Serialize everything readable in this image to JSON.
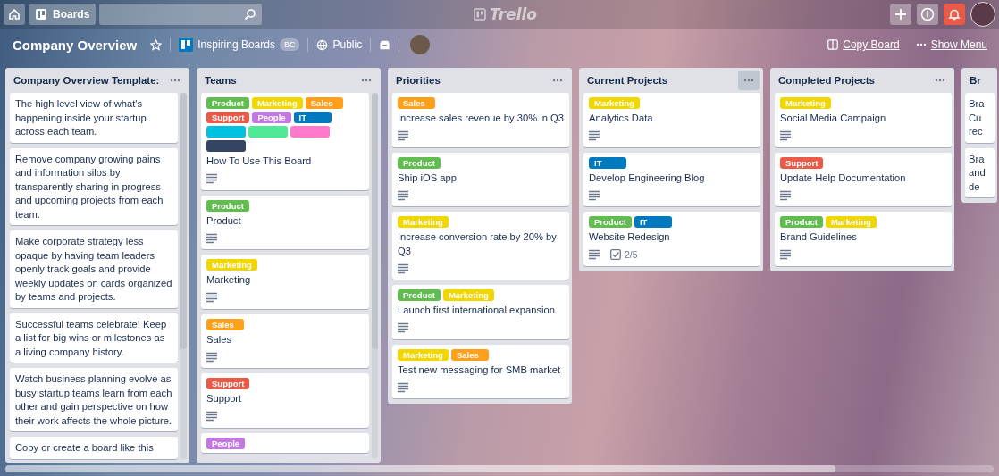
{
  "top_bar": {
    "boards_button": "Boards",
    "logo": "Trello"
  },
  "board_header": {
    "title": "Company Overview",
    "starred": false,
    "team": "Inspiring Boards",
    "team_badge": "BC",
    "visibility": "Public",
    "copy_board": "Copy Board",
    "show_menu": "Show Menu"
  },
  "lists": [
    {
      "title": "Company Overview Template:",
      "scrollbar": true,
      "cards": [
        {
          "title": "The high level view of what's happening inside your startup across each team.",
          "description": false
        },
        {
          "title": "Remove company growing pains and information silos by transparently sharing in progress and upcoming projects from each team.",
          "description": false
        },
        {
          "title": "Make corporate strategy less opaque by having team leaders openly track goals and provide weekly updates on cards organized by teams and projects.",
          "description": false
        },
        {
          "title": "Successful teams celebrate! Keep a list for big wins or milestones as a living company history.",
          "description": false
        },
        {
          "title": "Watch business planning evolve as busy startup teams learn from each other and gain perspective on how their work affects the whole picture.",
          "description": false
        },
        {
          "title": "Copy or create a board like this",
          "description": false
        }
      ]
    },
    {
      "title": "Teams",
      "scrollbar": true,
      "cards": [
        {
          "labels": [
            {
              "text": "Product",
              "color": "#61bd4f"
            },
            {
              "text": "Marketing",
              "color": "#f2d600"
            },
            {
              "text": "Sales",
              "color": "#ff9f1a"
            },
            {
              "text": "Support",
              "color": "#eb5a46"
            },
            {
              "text": "People",
              "color": "#c377e0"
            },
            {
              "text": "IT",
              "color": "#0079bf"
            },
            {
              "color": "#00c2e0"
            },
            {
              "color": "#51e898"
            },
            {
              "color": "#ff78cb"
            },
            {
              "color": "#344563"
            }
          ],
          "title": "How To Use This Board",
          "description": true
        },
        {
          "labels": [
            {
              "text": "Product",
              "color": "#61bd4f"
            }
          ],
          "title": "Product",
          "description": true
        },
        {
          "labels": [
            {
              "text": "Marketing",
              "color": "#f2d600"
            }
          ],
          "title": "Marketing",
          "description": true
        },
        {
          "labels": [
            {
              "text": "Sales",
              "color": "#ff9f1a"
            }
          ],
          "title": "Sales",
          "description": true
        },
        {
          "labels": [
            {
              "text": "Support",
              "color": "#eb5a46"
            }
          ],
          "title": "Support",
          "description": true
        },
        {
          "labels": [
            {
              "text": "People",
              "color": "#c377e0"
            }
          ],
          "description": false
        }
      ]
    },
    {
      "title": "Priorities",
      "scrollbar": false,
      "cards": [
        {
          "labels": [
            {
              "text": "Sales",
              "color": "#ff9f1a"
            }
          ],
          "title": "Increase sales revenue by 30% in Q3",
          "description": true
        },
        {
          "labels": [
            {
              "text": "Product",
              "color": "#61bd4f"
            }
          ],
          "title": "Ship iOS app",
          "description": true
        },
        {
          "labels": [
            {
              "text": "Marketing",
              "color": "#f2d600"
            }
          ],
          "title": "Increase conversion rate by 20% by Q3",
          "description": true
        },
        {
          "labels": [
            {
              "text": "Product",
              "color": "#61bd4f"
            },
            {
              "text": "Marketing",
              "color": "#f2d600"
            }
          ],
          "title": "Launch first international expansion",
          "description": true
        },
        {
          "labels": [
            {
              "text": "Marketing",
              "color": "#f2d600"
            },
            {
              "text": "Sales",
              "color": "#ff9f1a"
            }
          ],
          "title": "Test new messaging for SMB market",
          "description": true
        }
      ]
    },
    {
      "title": "Current Projects",
      "menu_highlighted": true,
      "scrollbar": false,
      "cards": [
        {
          "labels": [
            {
              "text": "Marketing",
              "color": "#f2d600"
            }
          ],
          "title": "Analytics Data",
          "description": true
        },
        {
          "labels": [
            {
              "text": "IT",
              "color": "#0079bf"
            }
          ],
          "title": "Develop Engineering Blog",
          "description": true
        },
        {
          "labels": [
            {
              "text": "Product",
              "color": "#61bd4f"
            },
            {
              "text": "IT",
              "color": "#0079bf"
            }
          ],
          "title": "Website Redesign",
          "description": true,
          "checklist": "2/5"
        }
      ]
    },
    {
      "title": "Completed Projects",
      "scrollbar": false,
      "cards": [
        {
          "labels": [
            {
              "text": "Marketing",
              "color": "#f2d600"
            }
          ],
          "title": "Social Media Campaign",
          "description": true
        },
        {
          "labels": [
            {
              "text": "Support",
              "color": "#eb5a46"
            }
          ],
          "title": "Update Help Documentation",
          "description": true
        },
        {
          "labels": [
            {
              "text": "Product",
              "color": "#61bd4f"
            },
            {
              "text": "Marketing",
              "color": "#f2d600"
            }
          ],
          "title": "Brand Guidelines",
          "description": true
        }
      ]
    },
    {
      "title": "Br",
      "cut": true,
      "scrollbar": false,
      "cards": [
        {
          "title": "Bra Cu rec",
          "description": false
        },
        {
          "title": "Bra and de",
          "description": false
        }
      ]
    }
  ]
}
